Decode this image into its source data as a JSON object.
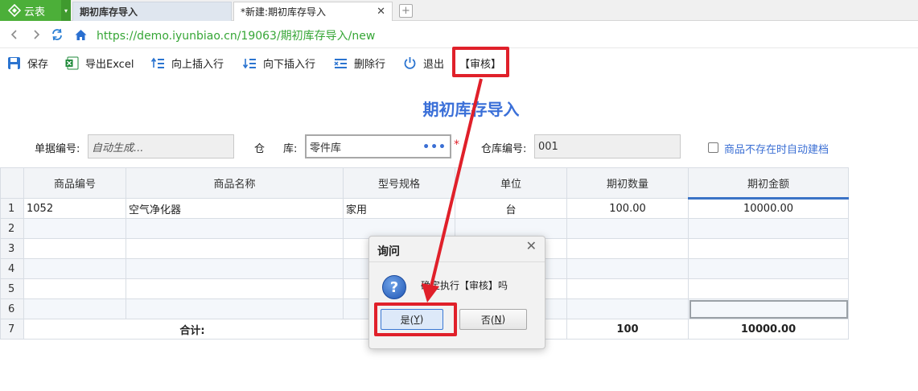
{
  "tabs": {
    "logo_label": "云表",
    "inactive_label": "期初库存导入",
    "active_label": "*新建:期初库存导入",
    "close_glyph": "✕",
    "newtab_glyph": "+"
  },
  "address": {
    "url": "https://demo.iyunbiao.cn/19063/期初库存导入/new"
  },
  "toolbar": {
    "save": "保存",
    "export": "导出Excel",
    "insert_up": "向上插入行",
    "insert_down": "向下插入行",
    "delete_row": "删除行",
    "exit": "退出",
    "audit": "【审核】"
  },
  "form": {
    "title": "期初库存导入",
    "doc_no_label": "单据编号:",
    "doc_no_value": "自动生成...",
    "warehouse_label_1": "仓",
    "warehouse_label_2": "库:",
    "warehouse_value": "零件库",
    "warehouse_more": "•••",
    "required_mark": "*",
    "warehouse_code_label": "仓库编号:",
    "warehouse_code_value": "001",
    "auto_create_label": "商品不存在时自动建档"
  },
  "grid": {
    "headers": [
      "商品编号",
      "商品名称",
      "型号规格",
      "单位",
      "期初数量",
      "期初金额"
    ],
    "rows": [
      {
        "n": "1",
        "code": "1052",
        "name": "空气净化器",
        "spec": "家用",
        "unit": "台",
        "qty": "100.00",
        "amount": "10000.00"
      },
      {
        "n": "2",
        "code": "",
        "name": "",
        "spec": "",
        "unit": "",
        "qty": "",
        "amount": ""
      },
      {
        "n": "3",
        "code": "",
        "name": "",
        "spec": "",
        "unit": "",
        "qty": "",
        "amount": ""
      },
      {
        "n": "4",
        "code": "",
        "name": "",
        "spec": "",
        "unit": "",
        "qty": "",
        "amount": ""
      },
      {
        "n": "5",
        "code": "",
        "name": "",
        "spec": "",
        "unit": "",
        "qty": "",
        "amount": ""
      },
      {
        "n": "6",
        "code": "",
        "name": "",
        "spec": "",
        "unit": "",
        "qty": "",
        "amount": ""
      }
    ],
    "total": {
      "n": "7",
      "label": "合计:",
      "qty": "100",
      "amount": "10000.00"
    }
  },
  "dialog": {
    "title": "询问",
    "close_glyph": "✕",
    "icon": "?",
    "message": "确定执行【审核】吗",
    "yes_text": "是(",
    "yes_key": "Y",
    "yes_end": ")",
    "no_text": "否(",
    "no_key": "N",
    "no_end": ")"
  },
  "colors": {
    "brand_green": "#4caf39",
    "title_blue": "#3a6fd8",
    "annotation_red": "#e0202a",
    "link_blue": "#3b6fd4"
  }
}
